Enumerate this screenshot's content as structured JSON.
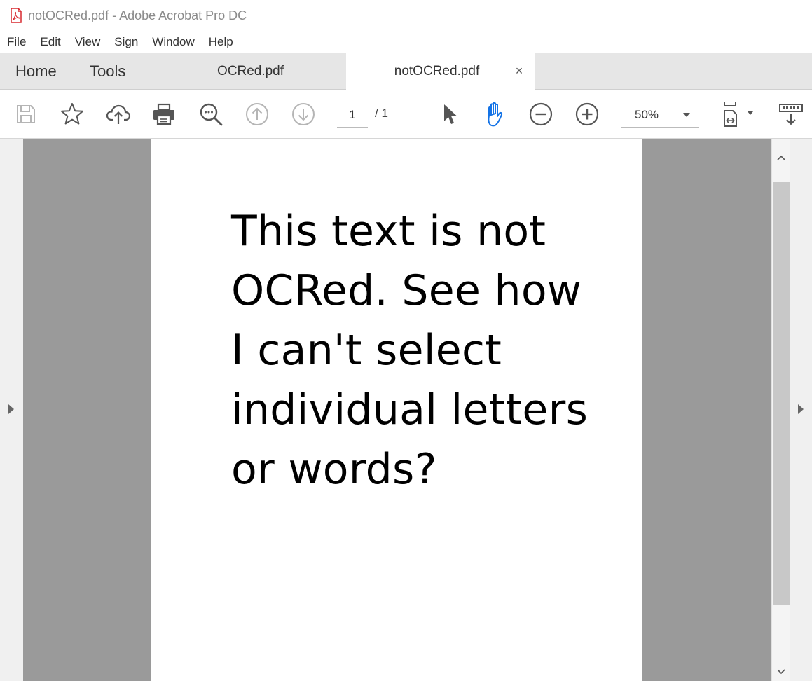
{
  "window": {
    "title": "notOCRed.pdf - Adobe Acrobat Pro DC",
    "icon": "pdf-icon"
  },
  "menu": {
    "items": [
      "File",
      "Edit",
      "View",
      "Sign",
      "Window",
      "Help"
    ]
  },
  "tabs": {
    "home": "Home",
    "tools": "Tools",
    "documents": [
      {
        "label": "OCRed.pdf",
        "active": false
      },
      {
        "label": "notOCRed.pdf",
        "active": true
      }
    ],
    "close_glyph": "×"
  },
  "toolbar": {
    "icons": [
      "save-icon",
      "star-icon",
      "cloud-upload-icon",
      "print-icon",
      "search-icon",
      "page-up-icon",
      "page-down-icon",
      "select-arrow-icon",
      "hand-icon",
      "zoom-out-icon",
      "zoom-in-icon",
      "page-fit-icon",
      "scroll-mode-icon"
    ],
    "page_current": "1",
    "page_total": "/ 1",
    "zoom": "50%",
    "active_tool_color": "#1473e6"
  },
  "document": {
    "lines": [
      "This text is not",
      "OCRed. See how",
      "I can't select",
      "individual letters",
      "or words?"
    ]
  },
  "colors": {
    "viewer_bg": "#9a9a9a",
    "tab_bar_bg": "#e6e6e6",
    "pdf_icon": "#d7282f"
  }
}
